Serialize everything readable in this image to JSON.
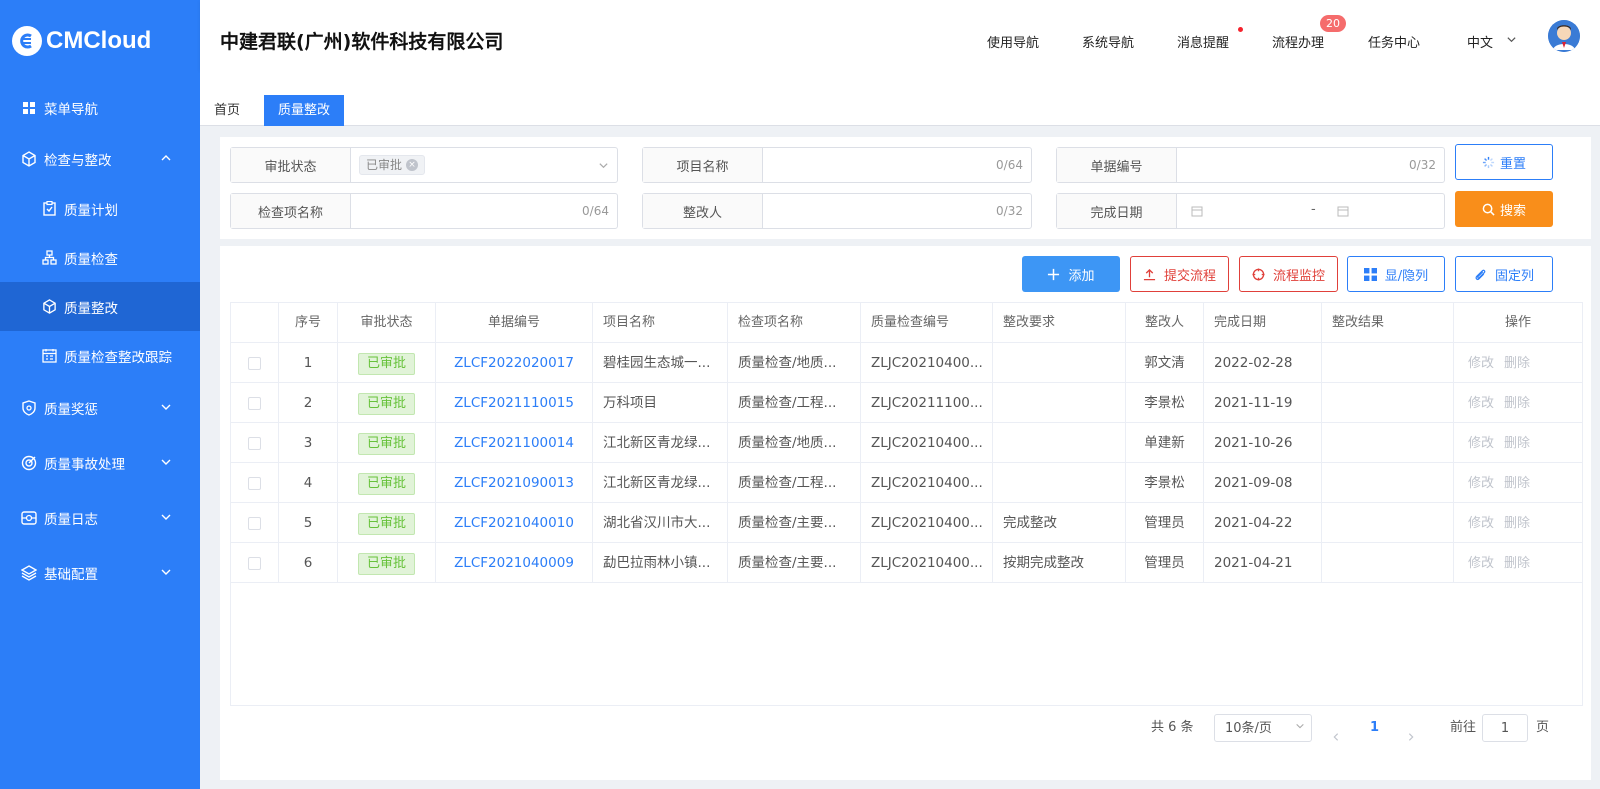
{
  "brand": {
    "name": "CMCloud"
  },
  "sidebar": {
    "items": [
      {
        "label": "菜单导航"
      },
      {
        "label": "检查与整改"
      },
      {
        "label": "质量计划"
      },
      {
        "label": "质量检查"
      },
      {
        "label": "质量整改"
      },
      {
        "label": "质量检查整改跟踪"
      },
      {
        "label": "质量奖惩"
      },
      {
        "label": "质量事故处理"
      },
      {
        "label": "质量日志"
      },
      {
        "label": "基础配置"
      }
    ]
  },
  "header": {
    "company": "中建君联(广州)软件科技有限公司",
    "nav": [
      "使用导航",
      "系统导航",
      "消息提醒",
      "流程办理",
      "任务中心"
    ],
    "flow_badge": "20",
    "language": "中文"
  },
  "tabs": [
    {
      "label": "首页"
    },
    {
      "label": "质量整改"
    }
  ],
  "filters": {
    "approval_status": {
      "label": "审批状态",
      "tag": "已审批"
    },
    "project_name": {
      "label": "项目名称",
      "counter": "0/64"
    },
    "doc_no": {
      "label": "单据编号",
      "counter": "0/32"
    },
    "check_item": {
      "label": "检查项名称",
      "counter": "0/64"
    },
    "rectifier": {
      "label": "整改人",
      "counter": "0/32"
    },
    "finish_date": {
      "label": "完成日期",
      "separator": "-"
    },
    "reset_label": "重置",
    "search_label": "搜索"
  },
  "toolbar": {
    "add": "添加",
    "submit_flow": "提交流程",
    "flow_monitor": "流程监控",
    "toggle_cols": "显/隐列",
    "fix_cols": "固定列"
  },
  "table": {
    "headers": [
      "序号",
      "审批状态",
      "单据编号",
      "项目名称",
      "检查项名称",
      "质量检查编号",
      "整改要求",
      "整改人",
      "完成日期",
      "整改结果",
      "操作"
    ],
    "rows": [
      {
        "no": "1",
        "status": "已审批",
        "doc": "ZLCF2022020017",
        "project": "碧桂园生态城一...",
        "item": "质量检查/地质...",
        "check_no": "ZLJC20210400...",
        "req": "",
        "person": "郭文清",
        "date": "2022-02-28",
        "result": ""
      },
      {
        "no": "2",
        "status": "已审批",
        "doc": "ZLCF2021110015",
        "project": "万科项目",
        "item": "质量检查/工程...",
        "check_no": "ZLJC20211100...",
        "req": "",
        "person": "李景松",
        "date": "2021-11-19",
        "result": ""
      },
      {
        "no": "3",
        "status": "已审批",
        "doc": "ZLCF2021100014",
        "project": "江北新区青龙绿...",
        "item": "质量检查/地质...",
        "check_no": "ZLJC20210400...",
        "req": "",
        "person": "单建新",
        "date": "2021-10-26",
        "result": ""
      },
      {
        "no": "4",
        "status": "已审批",
        "doc": "ZLCF2021090013",
        "project": "江北新区青龙绿...",
        "item": "质量检查/工程...",
        "check_no": "ZLJC20210400...",
        "req": "",
        "person": "李景松",
        "date": "2021-09-08",
        "result": ""
      },
      {
        "no": "5",
        "status": "已审批",
        "doc": "ZLCF2021040010",
        "project": "湖北省汉川市大...",
        "item": "质量检查/主要...",
        "check_no": "ZLJC20210400...",
        "req": "完成整改",
        "person": "管理员",
        "date": "2021-04-22",
        "result": ""
      },
      {
        "no": "6",
        "status": "已审批",
        "doc": "ZLCF2021040009",
        "project": "勐巴拉雨林小镇...",
        "item": "质量检查/主要...",
        "check_no": "ZLJC20210400...",
        "req": "按期完成整改",
        "person": "管理员",
        "date": "2021-04-21",
        "result": ""
      }
    ],
    "op_edit": "修改",
    "op_delete": "删除"
  },
  "pagination": {
    "total": "共 6 条",
    "page_size": "10条/页",
    "current": "1",
    "goto_prefix": "前往",
    "goto_value": "1",
    "goto_suffix": "页"
  }
}
